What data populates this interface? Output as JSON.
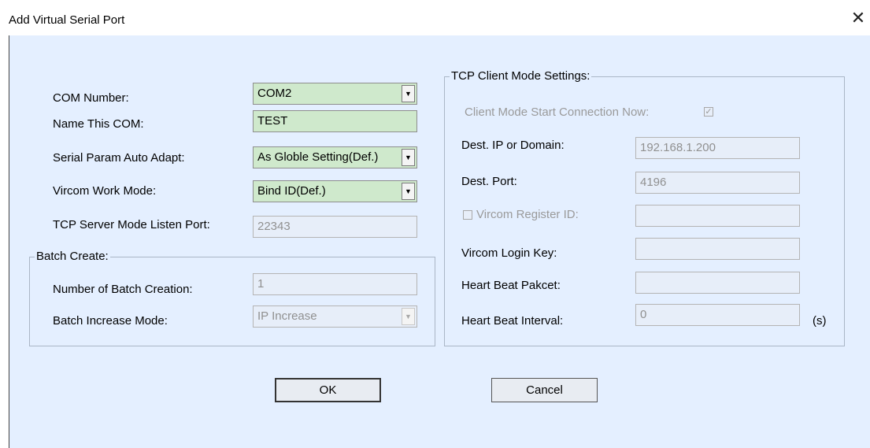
{
  "window": {
    "title": "Add Virtual Serial Port",
    "close_glyph": "✕"
  },
  "left": {
    "com_number": {
      "label": "COM Number:",
      "value": "COM2"
    },
    "name_this_com": {
      "label": "Name This COM:",
      "value": "TEST"
    },
    "serial_param_auto_adapt": {
      "label": "Serial Param Auto Adapt:",
      "value": "As Globle Setting(Def.)"
    },
    "vircom_work_mode": {
      "label": "Vircom Work Mode:",
      "value": "Bind ID(Def.)"
    },
    "tcp_server_listen_port": {
      "label": "TCP Server Mode Listen Port:",
      "value": "22343"
    }
  },
  "batch": {
    "legend": "Batch Create:",
    "number_of_batch_creation": {
      "label": "Number of Batch Creation:",
      "value": "1"
    },
    "batch_increase_mode": {
      "label": "Batch Increase Mode:",
      "value": "IP Increase"
    }
  },
  "tcp_client": {
    "legend": "TCP Client Mode Settings:",
    "start_connection_now": {
      "label": "Client Mode Start Connection Now:",
      "checked": true,
      "check_glyph": "✓"
    },
    "dest_ip": {
      "label": "Dest. IP or Domain:",
      "value": "192.168.1.200"
    },
    "dest_port": {
      "label": "Dest. Port:",
      "value": "4196"
    },
    "vircom_register_id": {
      "label": "Vircom Register ID:",
      "checked": false,
      "value": ""
    },
    "vircom_login_key": {
      "label": "Vircom Login Key:",
      "value": ""
    },
    "heart_beat_packet": {
      "label": "Heart Beat Pakcet:",
      "value": ""
    },
    "heart_beat_interval": {
      "label": "Heart Beat Interval:",
      "value": "0",
      "unit": "(s)"
    }
  },
  "buttons": {
    "ok": "OK",
    "cancel": "Cancel"
  },
  "icons": {
    "dropdown_arrow": "▼"
  },
  "colors": {
    "client_bg": "#e4efff",
    "active_field": "#cfe9cc",
    "disabled_field": "#e7eef9"
  }
}
